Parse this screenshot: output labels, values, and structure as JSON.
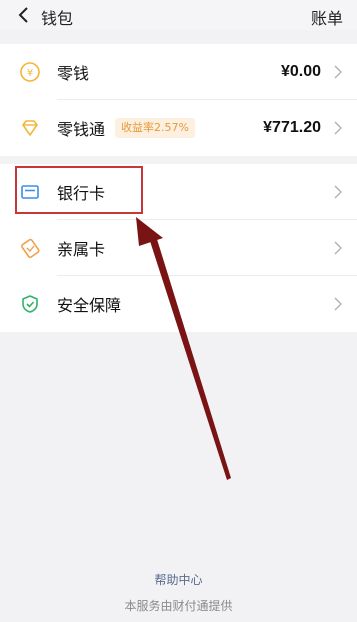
{
  "header": {
    "title": "钱包",
    "bill_label": "账单"
  },
  "wallet": {
    "change": {
      "label": "零钱",
      "value": "¥0.00"
    },
    "savings": {
      "label": "零钱通",
      "badge": "收益率2.57%",
      "value": "¥771.20"
    }
  },
  "services": {
    "items": [
      {
        "label": "银行卡"
      },
      {
        "label": "亲属卡"
      },
      {
        "label": "安全保障"
      }
    ]
  },
  "footer": {
    "help_center": "帮助中心",
    "provider": "本服务由财付通提供"
  },
  "colors": {
    "gold": "#f2b735",
    "blue": "#3d8ee6",
    "orange": "#f0a04b",
    "green": "#2fb36a",
    "highlight": "#c8363b",
    "arrow": "#7a1414"
  }
}
